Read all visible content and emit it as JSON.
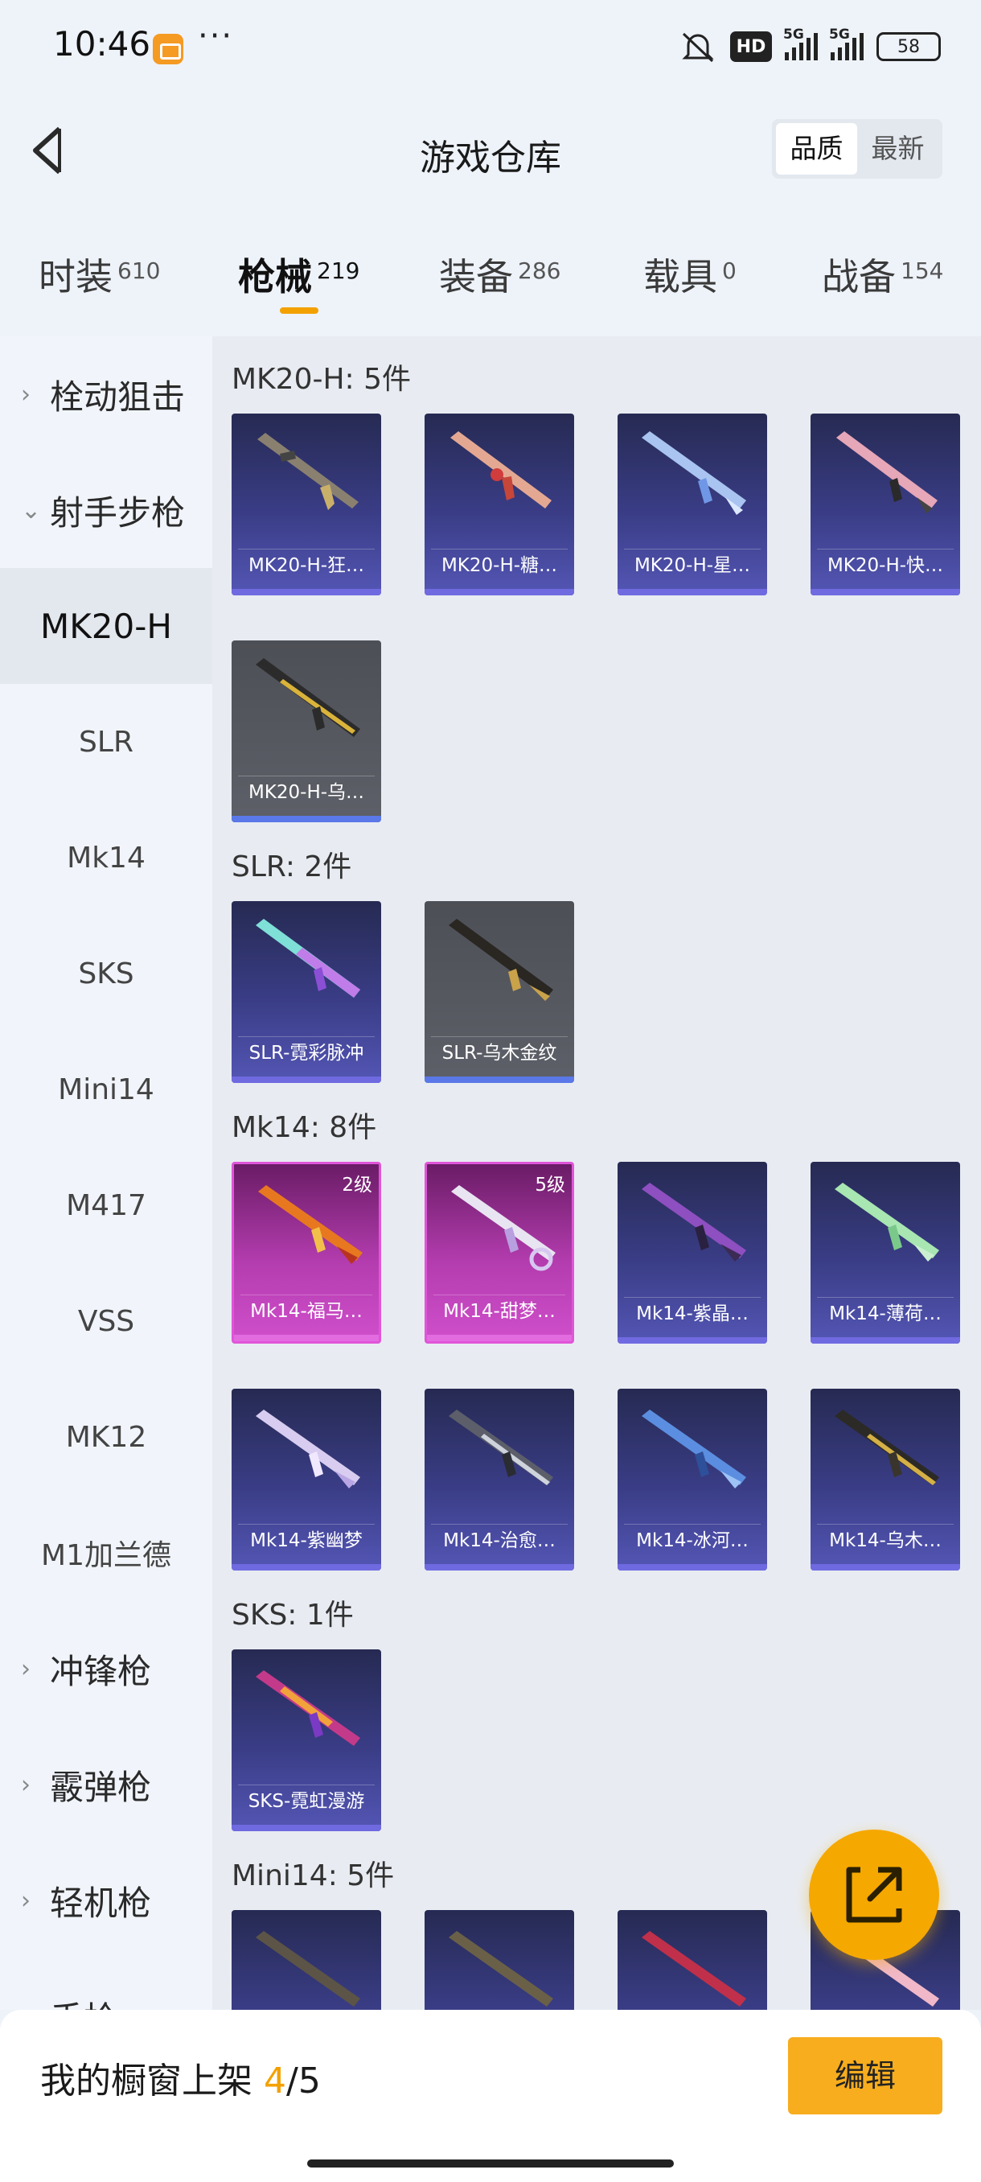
{
  "status_bar": {
    "time": "10:46",
    "more": "···",
    "hd": "HD",
    "net1": "5G",
    "net2": "5G",
    "battery": "58"
  },
  "header": {
    "title": "游戏仓库",
    "sort_quality": "品质",
    "sort_newest": "最新"
  },
  "tabs": [
    {
      "label": "时装",
      "count": "610"
    },
    {
      "label": "枪械",
      "count": "219"
    },
    {
      "label": "装备",
      "count": "286"
    },
    {
      "label": "载具",
      "count": "0"
    },
    {
      "label": "战备",
      "count": "154"
    }
  ],
  "sidebar": {
    "categories": {
      "bolt": "栓动狙击",
      "marksman": "射手步枪",
      "smg": "冲锋枪",
      "shotgun": "霰弹枪",
      "lmg": "轻机枪",
      "pistol": "手枪"
    },
    "subs": [
      "MK20-H",
      "SLR",
      "Mk14",
      "SKS",
      "Mini14",
      "M417",
      "VSS",
      "MK12",
      "M1加兰德"
    ]
  },
  "sections": {
    "mk20": {
      "title": "MK20-H: 5件",
      "items": [
        {
          "name": "MK20-H-狂…"
        },
        {
          "name": "MK20-H-糖…"
        },
        {
          "name": "MK20-H-星…"
        },
        {
          "name": "MK20-H-快…"
        },
        {
          "name": "MK20-H-乌…"
        }
      ]
    },
    "slr": {
      "title": "SLR: 2件",
      "items": [
        {
          "name": "SLR-霓彩脉冲"
        },
        {
          "name": "SLR-乌木金纹"
        }
      ]
    },
    "mk14": {
      "title": "Mk14: 8件",
      "items": [
        {
          "name": "Mk14-福马…",
          "level": "2级"
        },
        {
          "name": "Mk14-甜梦…",
          "level": "5级"
        },
        {
          "name": "Mk14-紫晶…"
        },
        {
          "name": "Mk14-薄荷…"
        },
        {
          "name": "Mk14-紫幽梦"
        },
        {
          "name": "Mk14-治愈…"
        },
        {
          "name": "Mk14-冰河…"
        },
        {
          "name": "Mk14-乌木…"
        }
      ]
    },
    "sks": {
      "title": "SKS: 1件",
      "items": [
        {
          "name": "SKS-霓虹漫游"
        }
      ]
    },
    "mini14": {
      "title": "Mini14: 5件"
    }
  },
  "footer": {
    "shelf_label": "我的橱窗上架",
    "shelf_current": "4",
    "shelf_sep": "/",
    "shelf_total": "5",
    "edit_label": "编辑"
  },
  "colors": {
    "accent": "#f3a100",
    "edit_button": "#f7ad1d"
  }
}
